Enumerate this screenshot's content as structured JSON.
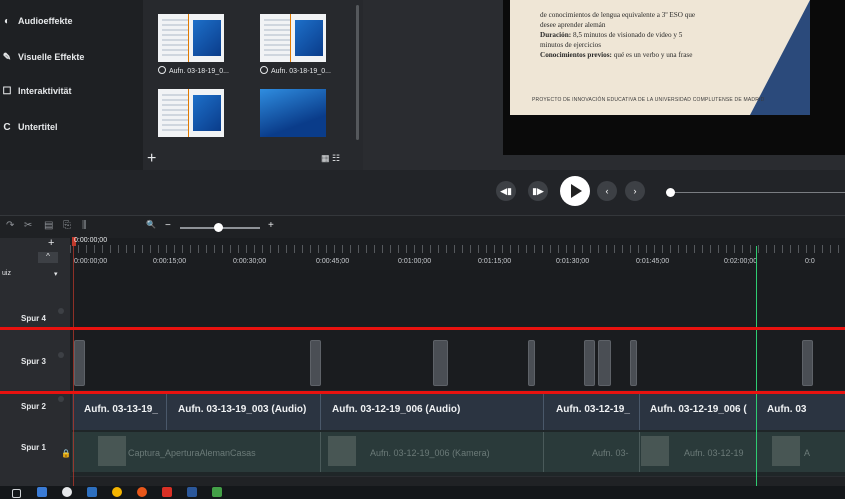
{
  "sidebar": {
    "items": [
      {
        "label": "Audioeffekte",
        "icon": "audio-effects-icon",
        "glyph": "◐"
      },
      {
        "label": "Visuelle Effekte",
        "icon": "magic-wand-icon",
        "glyph": "✎"
      },
      {
        "label": "Interaktivität",
        "icon": "interactivity-icon",
        "glyph": "☐"
      },
      {
        "label": "Untertitel",
        "icon": "captions-icon",
        "glyph": "C"
      }
    ]
  },
  "media_bin": {
    "items": [
      {
        "caption": "Aufn. 03-18-19_0..."
      },
      {
        "caption": "Aufn. 03-18-19_0..."
      },
      {
        "caption": ""
      },
      {
        "caption": ""
      }
    ],
    "add_glyph": "+",
    "view_glyph": "▦ ☷"
  },
  "slide": {
    "line1": "de conocimientos de lengua equivalente a 3º ESO que",
    "line2": "desee aprender alemán",
    "duration_label": "Duración:",
    "duration_value": "8,5 minutos de visionado de video y 5",
    "line4": "minutos de ejercicios",
    "prev_label": "Conocimientos previos:",
    "prev_value": "qué es un verbo y una frase",
    "footer": "PROYECTO DE INNOVACIÓN EDUCATIVA DE LA UNIVERSIDAD COMPLUTENSE DE MADRID"
  },
  "playback": {
    "prev_frame": "◀▮",
    "next_frame": "▮▶",
    "prev_marker": "‹",
    "next_marker": "›"
  },
  "toolbar": {
    "redo": "↷",
    "cut": "✂",
    "copy": "▤",
    "paste": "⎘",
    "split": "⫼",
    "zoom_glyph": "🔍",
    "zoom_minus": "−",
    "zoom_plus": "+",
    "add_track": "+",
    "collapse": "^"
  },
  "timeline": {
    "playhead_time": "0:00:00;00",
    "ticks": [
      "0:00:00;00",
      "0:00:15;00",
      "0:00:30;00",
      "0:00:45;00",
      "0:01:00;00",
      "0:01:15;00",
      "0:01:30;00",
      "0:01:45;00",
      "0:02:00;00",
      "0:0"
    ],
    "quiz_label": "uiz",
    "tracks": [
      {
        "name": "Spur 4"
      },
      {
        "name": "Spur 3"
      },
      {
        "name": "Spur 2"
      },
      {
        "name": "Spur 1"
      }
    ],
    "spur2_clips": [
      "Aufn. 03-13-19_",
      "Aufn. 03-13-19_003 (Audio)",
      "Aufn. 03-12-19_006 (Audio)",
      "Aufn. 03-12-19_",
      "Aufn. 03-12-19_006 (",
      "Aufn. 03"
    ],
    "spur1_clips": [
      "Captura_AperturaAlemanCasas",
      "Aufn. 03-12-19_006 (Kamera)",
      "Aufn. 03-",
      "Aufn. 03-12-19",
      "A"
    ]
  },
  "colors": {
    "guide_lines": "#e8120f",
    "playhead": "#c0392b",
    "marker": "#2ecc71"
  }
}
